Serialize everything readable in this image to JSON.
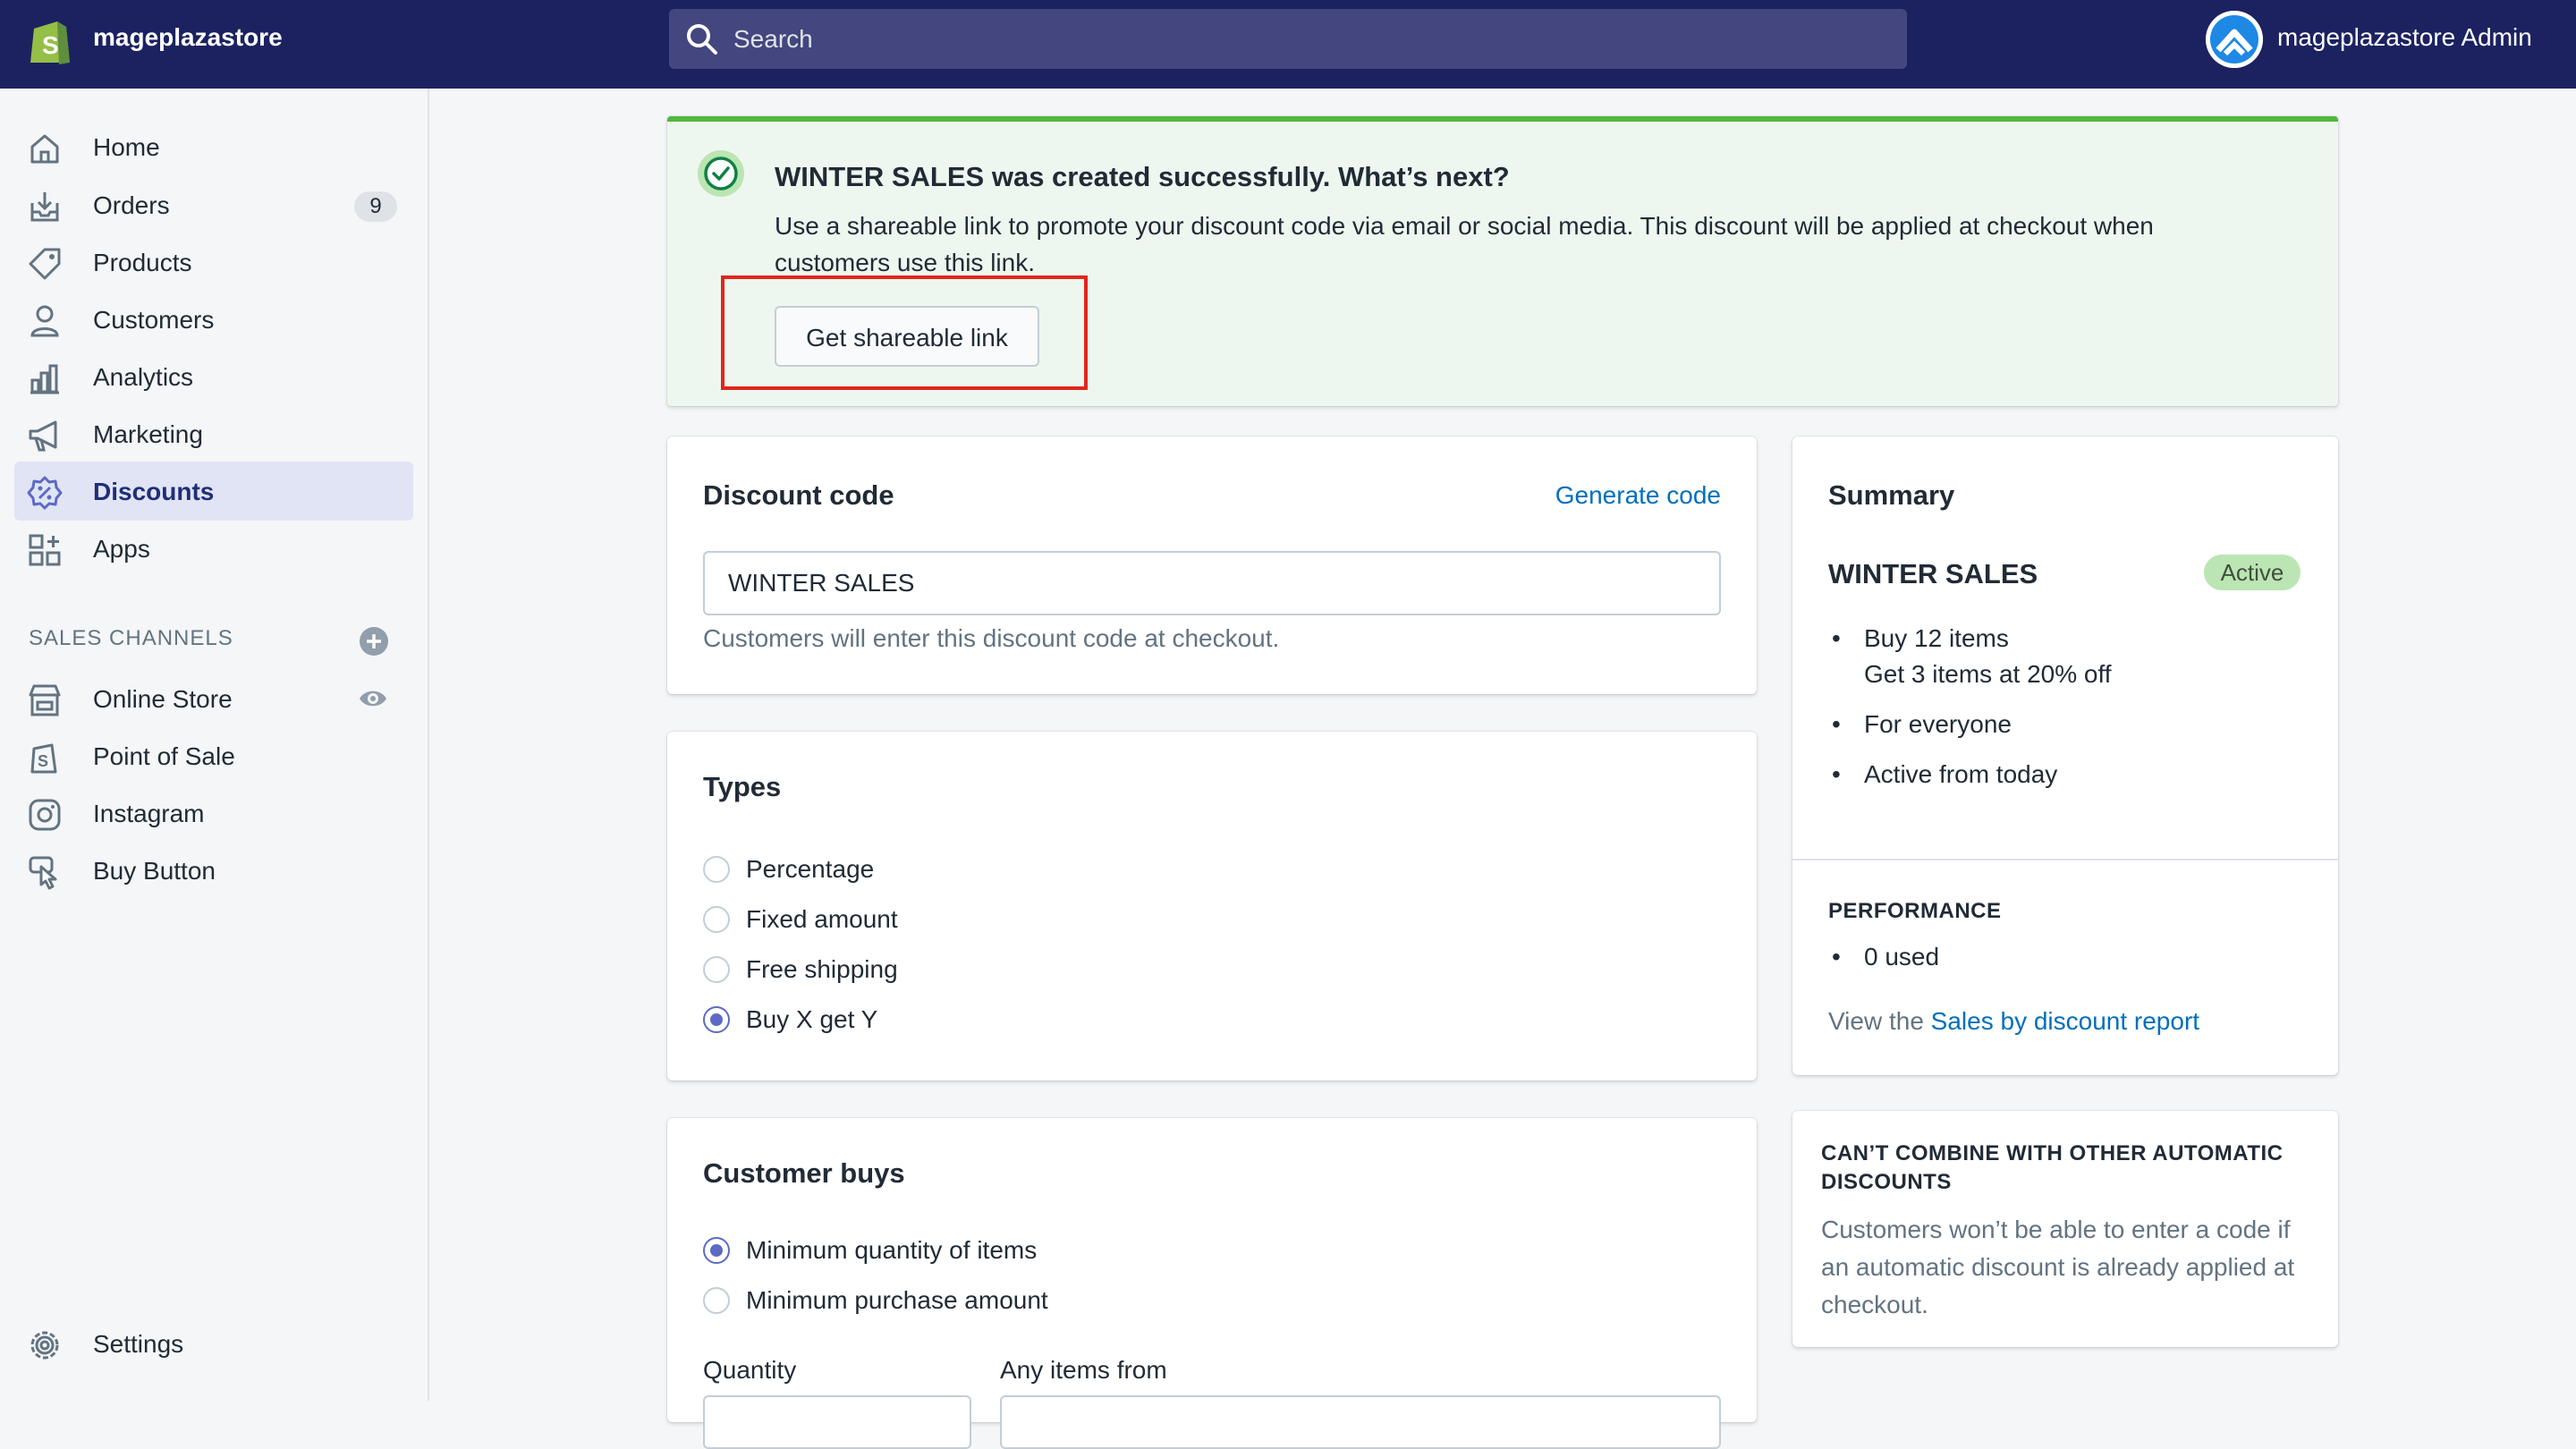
{
  "topbar": {
    "store_name": "mageplazastore",
    "search_placeholder": "Search",
    "admin_name": "mageplazastore Admin"
  },
  "sidebar": {
    "items": [
      {
        "label": "Home",
        "icon": "home-icon"
      },
      {
        "label": "Orders",
        "icon": "orders-icon",
        "badge": "9"
      },
      {
        "label": "Products",
        "icon": "tag-icon"
      },
      {
        "label": "Customers",
        "icon": "person-icon"
      },
      {
        "label": "Analytics",
        "icon": "bar-chart-icon"
      },
      {
        "label": "Marketing",
        "icon": "megaphone-icon"
      },
      {
        "label": "Discounts",
        "icon": "discount-icon",
        "active": true
      },
      {
        "label": "Apps",
        "icon": "apps-icon"
      }
    ],
    "channels_title": "SALES CHANNELS",
    "channels": [
      {
        "label": "Online Store",
        "icon": "store-icon"
      },
      {
        "label": "Point of Sale",
        "icon": "pos-bag-icon"
      },
      {
        "label": "Instagram",
        "icon": "instagram-icon"
      },
      {
        "label": "Buy Button",
        "icon": "buy-button-icon"
      }
    ],
    "settings_label": "Settings"
  },
  "banner": {
    "title": "WINTER SALES was created successfully. What’s next?",
    "body": "Use a shareable link to promote your discount code via email or social media. This discount will be applied at checkout when customers use this link.",
    "button_label": "Get shareable link"
  },
  "discount_code": {
    "title": "Discount code",
    "generate_label": "Generate code",
    "value": "WINTER SALES",
    "help": "Customers will enter this discount code at checkout."
  },
  "types": {
    "title": "Types",
    "options": [
      "Percentage",
      "Fixed amount",
      "Free shipping",
      "Buy X get Y"
    ],
    "selected": "Buy X get Y"
  },
  "customer_buys": {
    "title": "Customer buys",
    "options": [
      "Minimum quantity of items",
      "Minimum purchase amount"
    ],
    "selected": "Minimum quantity of items",
    "quantity_label": "Quantity",
    "any_items_label": "Any items from"
  },
  "summary": {
    "title": "Summary",
    "code_name": "WINTER SALES",
    "status": "Active",
    "bullets": [
      "Buy 12 items",
      "Get 3 items at 20% off",
      "For everyone",
      "Active from today"
    ],
    "performance_title": "PERFORMANCE",
    "performance_bullet": "0 used",
    "view_prefix": "View the",
    "report_link": "Sales by discount report"
  },
  "combine": {
    "title_line1": "CAN’T COMBINE WITH OTHER AUTOMATIC",
    "title_line2": "DISCOUNTS",
    "body": "Customers won’t be able to enter a code if an automatic discount is already applied at checkout."
  },
  "colors": {
    "topbar": "#1c2260",
    "accent": "#5c6ac4",
    "success": "#50b83c",
    "link": "#006fbb",
    "highlight": "#e0261b"
  }
}
